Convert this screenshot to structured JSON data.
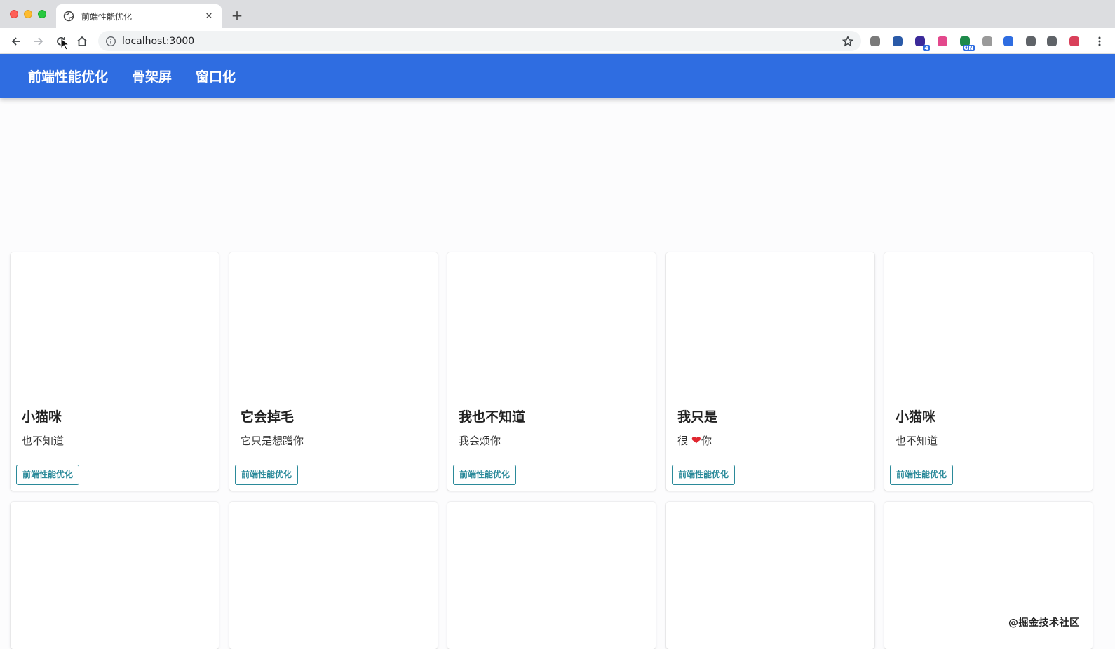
{
  "browser": {
    "tab_title": "前端性能优化",
    "tab_close": "✕",
    "new_tab": "+",
    "url": "localhost:3000",
    "extensions": [
      {
        "name": "vue-devtools-icon",
        "color": "#7a7a7a"
      },
      {
        "name": "react-devtools-icon",
        "color": "#2a5aa8"
      },
      {
        "name": "apollo-extension-icon",
        "color": "#3b2a9a",
        "badge": "4"
      },
      {
        "name": "colorzilla-icon",
        "color": "#e3488c"
      },
      {
        "name": "toggle-extension-icon",
        "color": "#1e8a4a",
        "badge": "ON"
      },
      {
        "name": "clock-extension-icon",
        "color": "#9a9a9a"
      },
      {
        "name": "shield-extension-icon",
        "color": "#2f6de1"
      },
      {
        "name": "puzzle-icon",
        "color": "#5f6368"
      },
      {
        "name": "reading-list-icon",
        "color": "#5f6368"
      },
      {
        "name": "profile-avatar-icon",
        "color": "#d9405a"
      }
    ]
  },
  "app": {
    "accent": "#2f6de1",
    "nav": [
      {
        "label": "前端性能优化"
      },
      {
        "label": "骨架屏"
      },
      {
        "label": "窗口化"
      }
    ]
  },
  "cards": [
    {
      "title": "小猫咪",
      "desc": "也不知道",
      "tag": "前端性能优化"
    },
    {
      "title": "它会掉毛",
      "desc": "它只是想蹭你",
      "tag": "前端性能优化"
    },
    {
      "title": "我也不知道",
      "desc": "我会烦你",
      "tag": "前端性能优化"
    },
    {
      "title": "我只是",
      "desc_pre": "很",
      "desc_emoji": "❤",
      "desc_post": "你",
      "tag": "前端性能优化"
    },
    {
      "title": "小猫咪",
      "desc": "也不知道",
      "tag": "前端性能优化"
    }
  ],
  "watermark": "@掘金技术社区"
}
